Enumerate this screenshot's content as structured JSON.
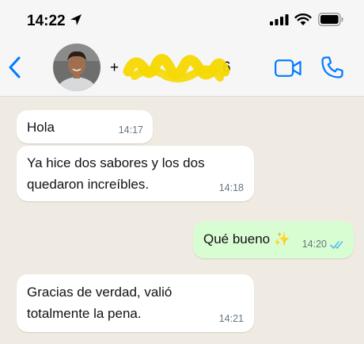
{
  "status_bar": {
    "time": "14:22"
  },
  "header": {
    "contact_name_prefix": "+",
    "contact_name_suffix": "6"
  },
  "messages": [
    {
      "direction": "incoming",
      "text": "Hola",
      "time": "14:17"
    },
    {
      "direction": "incoming",
      "text": "Ya hice dos sabores y los dos\nquedaron increíbles.",
      "time": "14:18"
    },
    {
      "direction": "outgoing",
      "text": "Qué bueno ✨",
      "time": "14:20",
      "read": true
    },
    {
      "direction": "incoming",
      "text": "Gracias de verdad, valió\ntotalmente la pena.",
      "time": "14:21"
    }
  ],
  "colors": {
    "accent": "#007aff",
    "incoming_bubble": "#ffffff",
    "outgoing_bubble": "#d9fdd3",
    "chat_background": "#efeae2",
    "read_ticks": "#53bdeb",
    "redaction": "#f5d800"
  },
  "icons": [
    "location-arrow-icon",
    "signal-icon",
    "wifi-icon",
    "battery-icon",
    "back-chevron-icon",
    "video-call-icon",
    "phone-call-icon",
    "double-check-icon"
  ]
}
